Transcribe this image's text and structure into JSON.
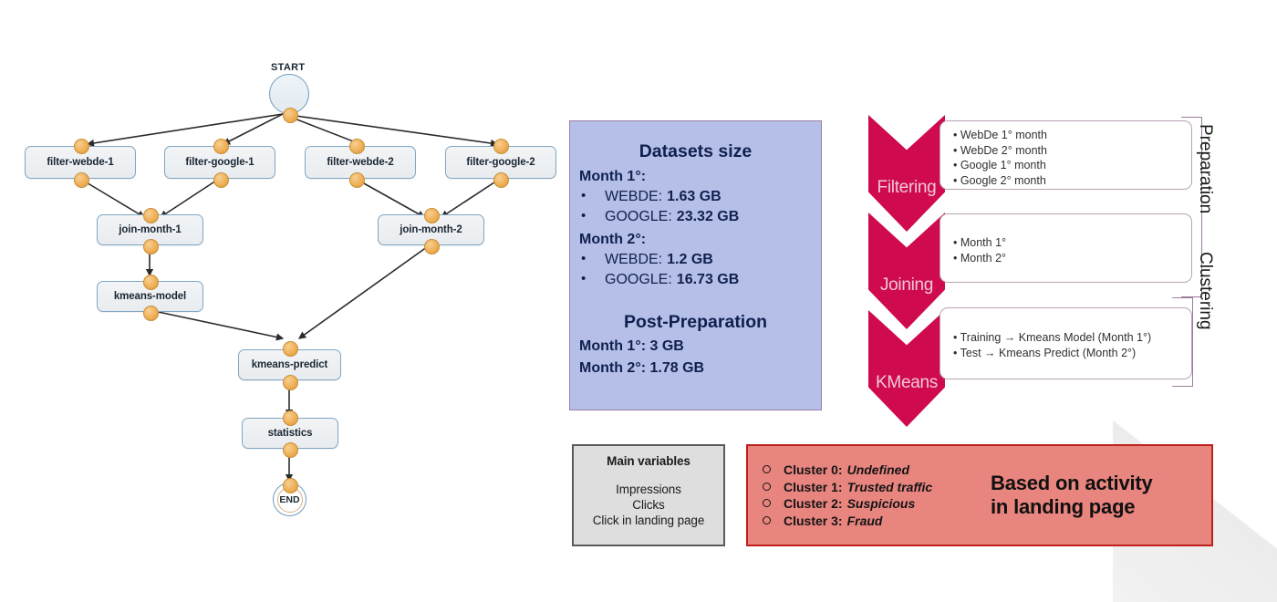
{
  "workflow": {
    "start_label": "START",
    "end_label": "END",
    "nodes": [
      {
        "id": "filter-webde-1",
        "label": "filter-webde-1"
      },
      {
        "id": "filter-google-1",
        "label": "filter-google-1"
      },
      {
        "id": "filter-webde-2",
        "label": "filter-webde-2"
      },
      {
        "id": "filter-google-2",
        "label": "filter-google-2"
      },
      {
        "id": "join-month-1",
        "label": "join-month-1"
      },
      {
        "id": "join-month-2",
        "label": "join-month-2"
      },
      {
        "id": "kmeans-model",
        "label": "kmeans-model"
      },
      {
        "id": "kmeans-predict",
        "label": "kmeans-predict"
      },
      {
        "id": "statistics",
        "label": "statistics"
      }
    ],
    "edges": [
      [
        "START",
        "filter-webde-1"
      ],
      [
        "START",
        "filter-google-1"
      ],
      [
        "START",
        "filter-webde-2"
      ],
      [
        "START",
        "filter-google-2"
      ],
      [
        "filter-webde-1",
        "join-month-1"
      ],
      [
        "filter-google-1",
        "join-month-1"
      ],
      [
        "filter-webde-2",
        "join-month-2"
      ],
      [
        "filter-google-2",
        "join-month-2"
      ],
      [
        "join-month-1",
        "kmeans-model"
      ],
      [
        "kmeans-model",
        "kmeans-predict"
      ],
      [
        "join-month-2",
        "kmeans-predict"
      ],
      [
        "kmeans-predict",
        "statistics"
      ],
      [
        "statistics",
        "END"
      ]
    ],
    "colors": {
      "node_border": "#7fa6c4",
      "port": "#eead51",
      "edge": "#2b2b2b"
    }
  },
  "datasets": {
    "title": "Datasets size",
    "month1_label": "Month 1°:",
    "month1_rows": [
      {
        "name": "WEBDE:",
        "value": "1.63 GB"
      },
      {
        "name": "GOOGLE:",
        "value": "23.32 GB"
      }
    ],
    "month2_label": "Month 2°:",
    "month2_rows": [
      {
        "name": "WEBDE:",
        "value": "1.2 GB"
      },
      {
        "name": "GOOGLE:",
        "value": "16.73 GB"
      }
    ],
    "post_title": "Post-Preparation",
    "post_rows": [
      "Month 1°: 3 GB",
      "Month 2°: 1.78 GB"
    ],
    "bg_color": "#b5bfe8",
    "border_color": "#9c7fa8"
  },
  "process": {
    "accent_color": "#cf0a4f",
    "steps": [
      {
        "label": "Filtering",
        "items": [
          "WebDe 1° month",
          "WebDe 2° month",
          "Google 1° month",
          "Google 2° month"
        ]
      },
      {
        "label": "Joining",
        "items": [
          "Month 1°",
          "Month 2°"
        ]
      },
      {
        "label": "KMeans",
        "items": [
          "Training → Kmeans Model (Month 1°)",
          "Test → Kmeans Predict (Month 2°)"
        ]
      }
    ],
    "groups": [
      {
        "label": "Preparation"
      },
      {
        "label": "Clustering"
      }
    ]
  },
  "main_variables": {
    "title": "Main variables",
    "items": [
      "Impressions",
      "Clicks",
      "Click in landing page"
    ],
    "bg_color": "#dedede",
    "border_color": "#5a5a5a"
  },
  "clusters": {
    "rows": [
      {
        "name": "Cluster 0:",
        "value": "Undefined"
      },
      {
        "name": "Cluster 1:",
        "value": "Trusted traffic"
      },
      {
        "name": "Cluster 2:",
        "value": "Suspicious"
      },
      {
        "name": "Cluster 3:",
        "value": "Fraud"
      }
    ],
    "tagline_line1": "Based on activity",
    "tagline_line2": "in landing page",
    "bg_color": "#e8857f",
    "border_color": "#c0201b"
  }
}
